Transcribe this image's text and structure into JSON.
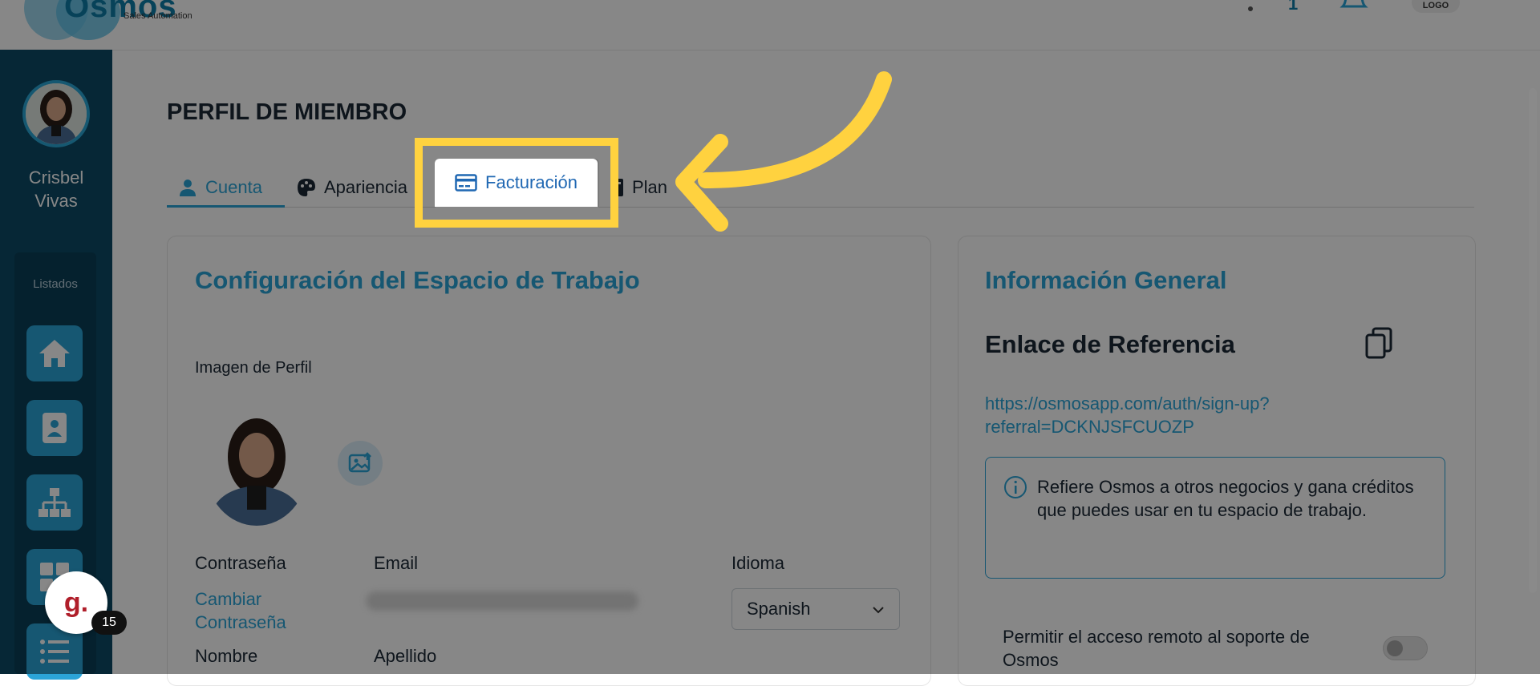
{
  "app": {
    "logo_text": "Osmos",
    "logo_subtitle": "Sales Automation",
    "top_logo_label": "LOGO",
    "notification_count": "1"
  },
  "sidebar": {
    "user_name_first": "Crisbel",
    "user_name_last": "Vivas",
    "section_title": "Listados",
    "nav_icons": [
      "home-icon",
      "contact-card-icon",
      "org-chart-icon",
      "dashboard-grid-icon",
      "list-icon"
    ]
  },
  "page": {
    "title": "PERFIL DE MIEMBRO",
    "tabs": [
      {
        "label": "Cuenta",
        "icon": "user-icon",
        "active": true
      },
      {
        "label": "Apariencia",
        "icon": "palette-icon",
        "active": false
      },
      {
        "label": "Facturación",
        "icon": "credit-card-icon",
        "active": false
      },
      {
        "label": "Plan",
        "icon": "plan-icon",
        "active": false
      }
    ]
  },
  "workspace_card": {
    "title": "Configuración del Espacio de Trabajo",
    "profile_image_label": "Imagen de Perfil",
    "password_label": "Contraseña",
    "change_password_link": "Cambiar Contraseña",
    "email_label": "Email",
    "language_label": "Idioma",
    "language_value": "Spanish",
    "first_name_label": "Nombre",
    "last_name_label": "Apellido"
  },
  "general_card": {
    "title": "Información General",
    "referral_heading": "Enlace de Referencia",
    "referral_link_line1": "https://osmosapp.com/auth/sign-up?",
    "referral_link_line2": "referral=DCKNJSFCUOZP",
    "info_text": "Refiere Osmos a otros negocios y gana créditos que puedes usar en tu espacio de trabajo.",
    "remote_access_label": "Permitir el acceso remoto al soporte de Osmos",
    "remote_access_enabled": false
  },
  "widget": {
    "letter": "g.",
    "count": "15"
  },
  "colors": {
    "accent": "#2ba4d8",
    "sidebar": "#0d4a66",
    "highlight": "#ffd23f",
    "heading": "#1c2836"
  }
}
